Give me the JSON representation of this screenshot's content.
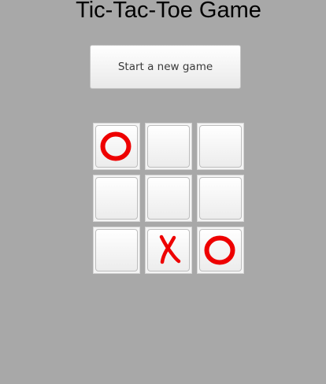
{
  "app": {
    "title": "Tic-Tac-Toe Game"
  },
  "controls": {
    "new_game_label": "Start a new game"
  },
  "board": {
    "cells": [
      "O",
      "",
      "",
      "",
      "",
      "",
      "",
      "X",
      "O"
    ]
  },
  "colors": {
    "background": "#a8a8a8",
    "mark": "#ee0000"
  }
}
